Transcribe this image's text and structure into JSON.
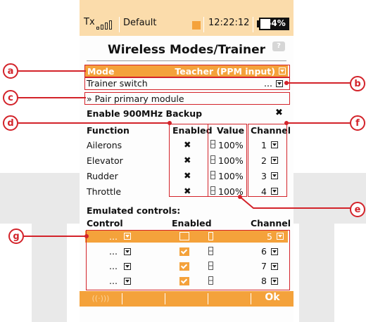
{
  "status": {
    "tx": "Tx",
    "model": "Default",
    "time": "12:22:12",
    "battery": "64%"
  },
  "title": "Wireless Modes/Trainer",
  "mode": {
    "label": "Mode",
    "value": "Teacher (PPM input)"
  },
  "trainer_switch": {
    "label": "Trainer switch",
    "value": "..."
  },
  "pair_label": "» Pair primary module",
  "backup": {
    "label": "Enable 900MHz Backup",
    "mark": "✖"
  },
  "function_table": {
    "headers": [
      "Function",
      "Enabled",
      "Value",
      "Channel"
    ],
    "rows": [
      {
        "name": "Ailerons",
        "enabled": "✖",
        "value": "100%",
        "channel": "1"
      },
      {
        "name": "Elevator",
        "enabled": "✖",
        "value": "100%",
        "channel": "2"
      },
      {
        "name": "Rudder",
        "enabled": "✖",
        "value": "100%",
        "channel": "3"
      },
      {
        "name": "Throttle",
        "enabled": "✖",
        "value": "100%",
        "channel": "4"
      }
    ]
  },
  "emulated": {
    "title": "Emulated controls:",
    "headers": [
      "Control",
      "Enabled",
      "Channel"
    ],
    "rows": [
      {
        "control": "...",
        "channel": "5"
      },
      {
        "control": "...",
        "channel": "6"
      },
      {
        "control": "...",
        "channel": "7"
      },
      {
        "control": "...",
        "channel": "8"
      }
    ]
  },
  "footer": {
    "ok": "Ok"
  },
  "callouts": [
    "a",
    "b",
    "c",
    "d",
    "e",
    "f",
    "g"
  ]
}
